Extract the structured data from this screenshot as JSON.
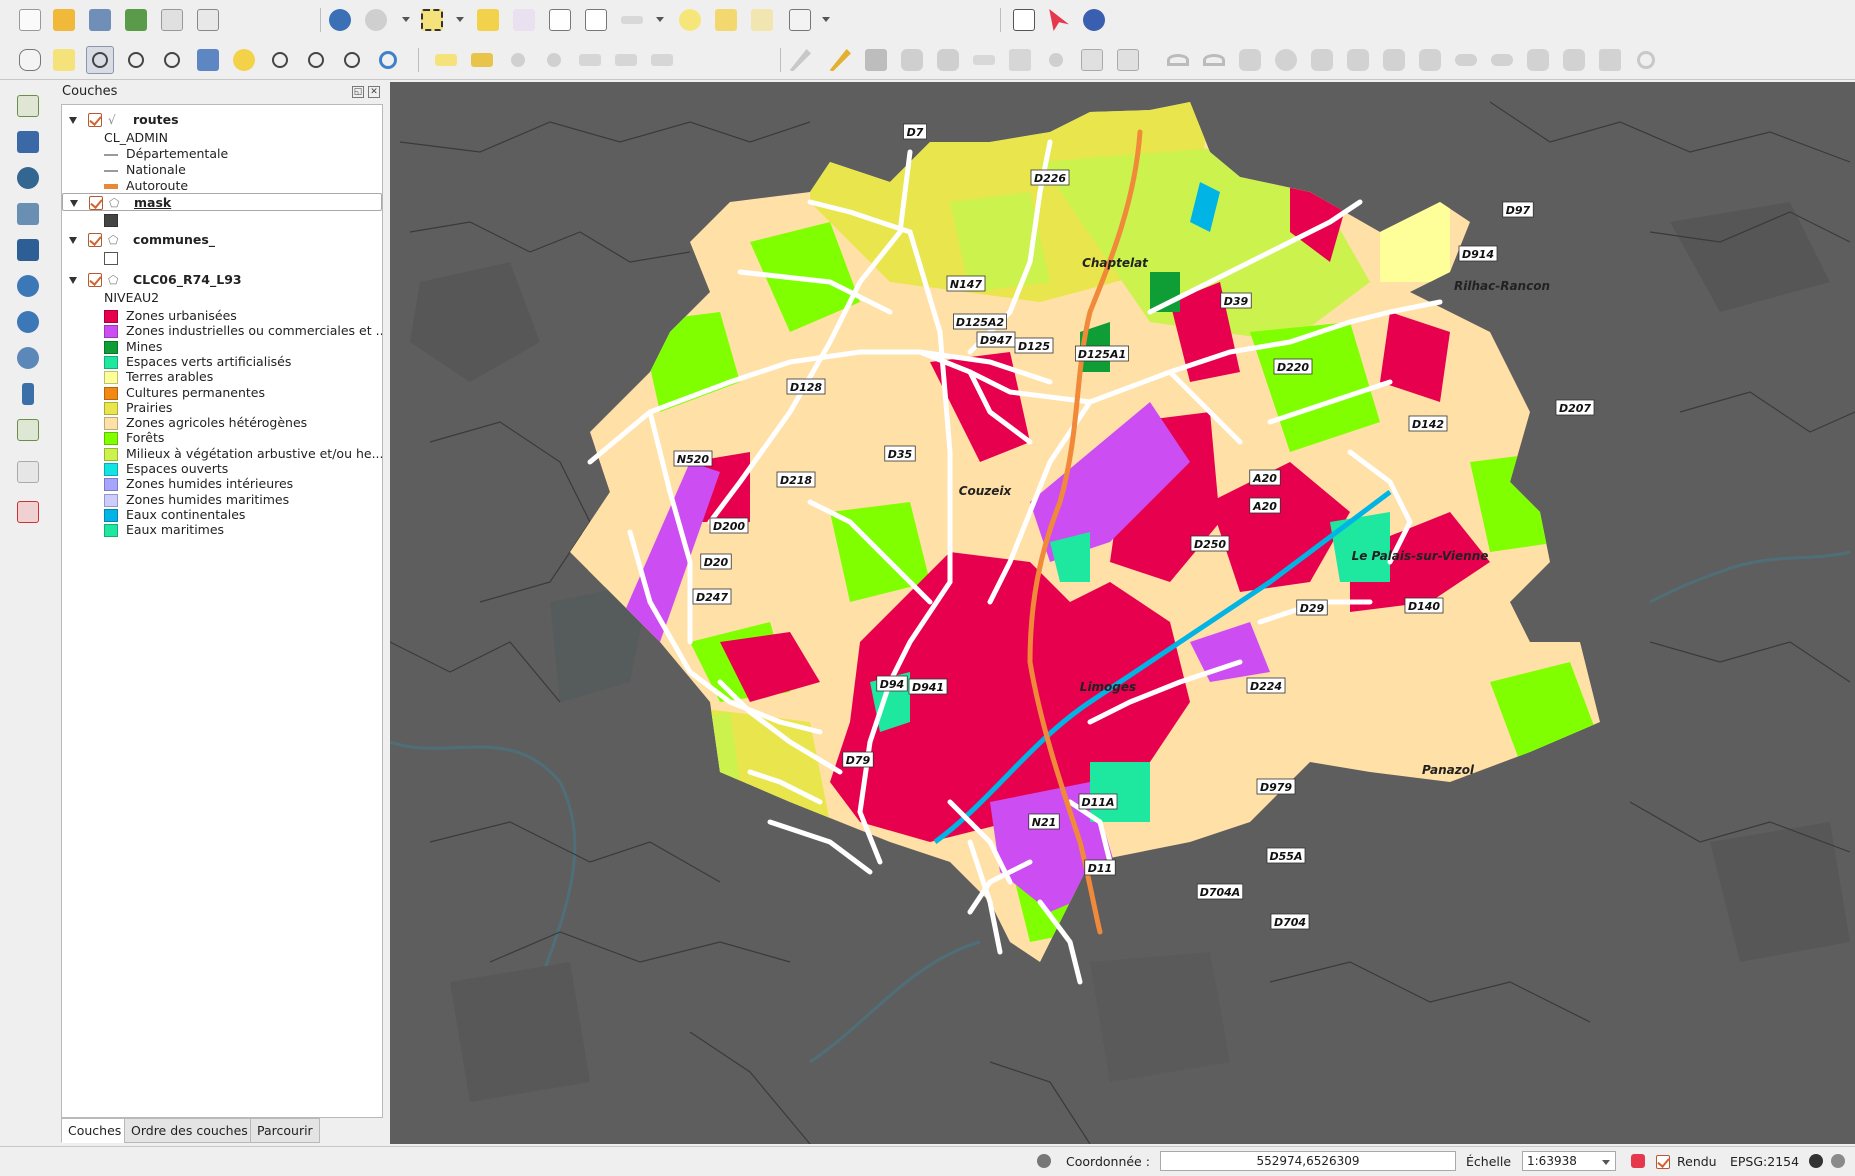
{
  "layers_panel": {
    "title": "Couches",
    "layers": [
      {
        "name": "routes",
        "field": "CL_ADMIN",
        "items": [
          {
            "label": "Départementale",
            "color": "#9a9a9a"
          },
          {
            "label": "Nationale",
            "color": "#9a9a9a"
          },
          {
            "label": "Autoroute",
            "color": "#e8883a"
          }
        ]
      },
      {
        "name": "mask",
        "swatch": "#444444"
      },
      {
        "name": "communes_",
        "swatch": "#ffffff"
      },
      {
        "name": "CLC06_R74_L93",
        "field": "NIVEAU2",
        "items": [
          {
            "label": "Zones urbanisées",
            "color": "#e6004d"
          },
          {
            "label": "Zones industrielles ou commerciales et ...",
            "color": "#cc4df2"
          },
          {
            "label": "Mines",
            "color": "#0f9d35"
          },
          {
            "label": "Espaces verts artificialisés",
            "color": "#1ee8a0"
          },
          {
            "label": "Terres arables",
            "color": "#ffff9a"
          },
          {
            "label": "Cultures permanentes",
            "color": "#f28a12"
          },
          {
            "label": "Prairies",
            "color": "#e8e64c"
          },
          {
            "label": "Zones agricoles hétérogènes",
            "color": "#ffe0a6"
          },
          {
            "label": "Forêts",
            "color": "#80ff00"
          },
          {
            "label": "Milieux à végétation arbustive et/ou he...",
            "color": "#ccf24d"
          },
          {
            "label": "Espaces ouverts",
            "color": "#14e3e3"
          },
          {
            "label": "Zones humides intérieures",
            "color": "#a6a6ff"
          },
          {
            "label": "Zones humides maritimes",
            "color": "#ccccff"
          },
          {
            "label": "Eaux continentales",
            "color": "#00b4e6"
          },
          {
            "label": "Eaux maritimes",
            "color": "#1ee8a0"
          }
        ]
      }
    ],
    "tabs": [
      "Couches",
      "Ordre des couches",
      "Parcourir"
    ]
  },
  "map": {
    "road_labels": [
      "D7",
      "D226",
      "D97",
      "D914",
      "Rilhac-Rancon",
      "D39",
      "N147",
      "D125A2",
      "D947",
      "D125",
      "D125A1",
      "D220",
      "D128",
      "D207",
      "D142",
      "N520",
      "D35",
      "D218",
      "A20",
      "A20",
      "D200",
      "D250",
      "D20",
      "D247",
      "D29",
      "D140",
      "D94",
      "D941",
      "D224",
      "D79",
      "D11A",
      "D979",
      "N21",
      "D55A",
      "D11",
      "D704A",
      "D704"
    ],
    "place_labels": [
      "Chaptelat",
      "Couzeix",
      "Limoges",
      "Le Palais-sur-Vienne",
      "Panazol"
    ]
  },
  "statusbar": {
    "coord_label": "Coordonnée :",
    "coord_value": "552974,6526309",
    "scale_label": "Échelle",
    "scale_value": "1:63938",
    "render_label": "Rendu",
    "crs": "EPSG:2154"
  }
}
